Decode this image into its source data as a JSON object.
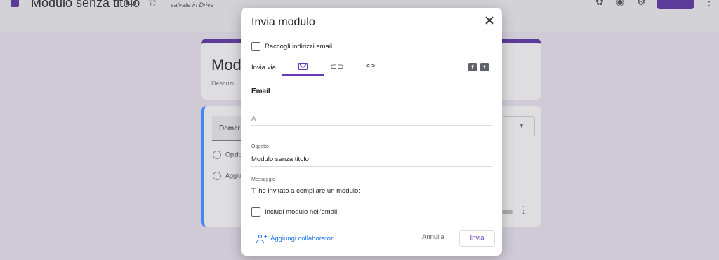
{
  "app": {
    "doc_title": "Modulo senza titolo",
    "saved_status": "salvate in Drive",
    "form_title": "Modu",
    "form_description": "Descrizi",
    "question_title": "Domar",
    "option_1": "Opzio",
    "option_2": "Aggiu"
  },
  "dialog": {
    "title": "Invia modulo",
    "collect_emails_label": "Raccogli indirizzi email",
    "send_via_label": "Invia via",
    "tabs": [
      {
        "name": "email",
        "icon": "mail-icon",
        "active": true
      },
      {
        "name": "link",
        "icon": "link-icon",
        "active": false
      },
      {
        "name": "embed",
        "icon": "code-icon",
        "active": false
      }
    ],
    "social": [
      {
        "name": "facebook",
        "glyph": "f"
      },
      {
        "name": "twitter",
        "glyph": "t"
      }
    ],
    "section_title": "Email",
    "to": {
      "placeholder": "A",
      "value": ""
    },
    "subject": {
      "label": "Oggetto",
      "value": "Modulo senza titolo"
    },
    "message": {
      "label": "Messaggio",
      "value": "Ti ho invitato a compilare un modulo:"
    },
    "include_form_label": "Includi modulo nell'email",
    "add_collaborators_label": "Aggiungi collaboratori",
    "cancel_label": "Annulla",
    "send_label": "Invia"
  },
  "colors": {
    "accent": "#673ab7",
    "link": "#1a73e8"
  }
}
